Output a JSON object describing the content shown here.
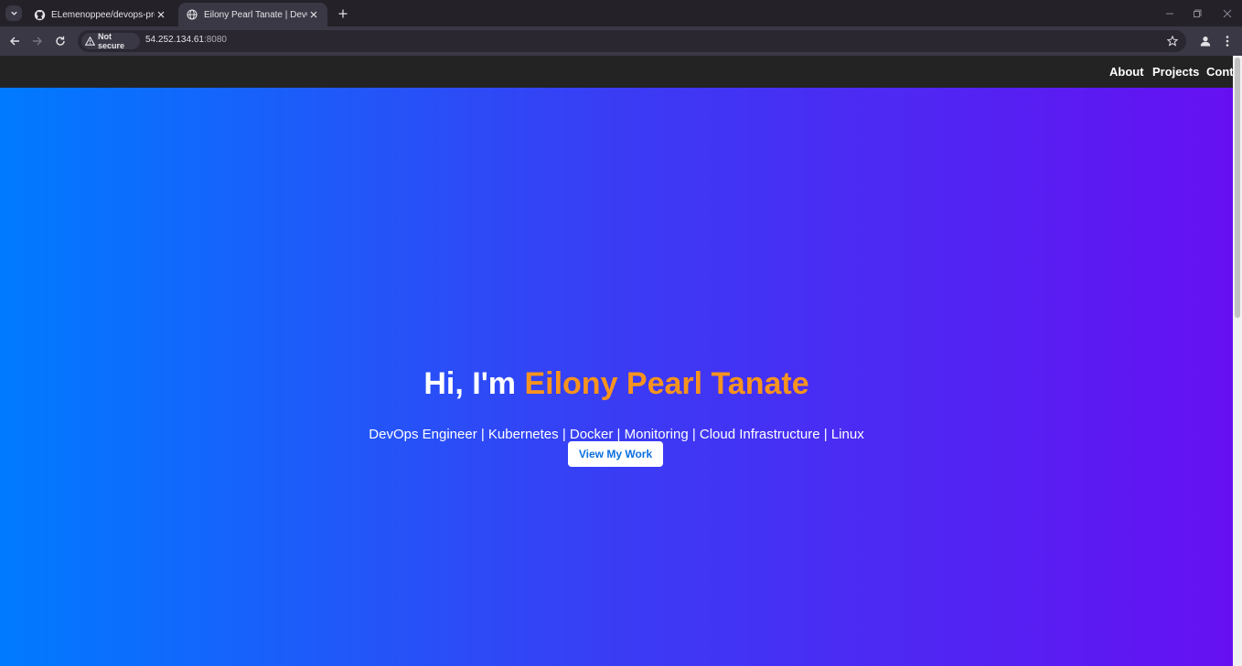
{
  "browser": {
    "tabs": [
      {
        "title": "ELemenoppee/devops-projects",
        "favicon": "github-icon",
        "active": false
      },
      {
        "title": "Eilony Pearl Tanate | DevOps Er",
        "favicon": "globe-icon",
        "active": true
      }
    ],
    "security_label": "Not secure",
    "url_host": "54.252.134.61",
    "url_port": ":8080"
  },
  "site": {
    "nav": [
      "About",
      "Projects",
      "Conta"
    ],
    "hero": {
      "greeting": "Hi, I'm ",
      "name": "Eilony Pearl Tanate",
      "subtitle": "DevOps Engineer | Kubernetes | Docker | Monitoring | Cloud Infrastructure | Linux",
      "cta": "View My Work"
    }
  },
  "colors": {
    "gradient_start": "#007bff",
    "gradient_end": "#6610f2",
    "name_accent": "#f7931e",
    "nav_bg": "#232323",
    "cta_text": "#0a6fe0"
  }
}
